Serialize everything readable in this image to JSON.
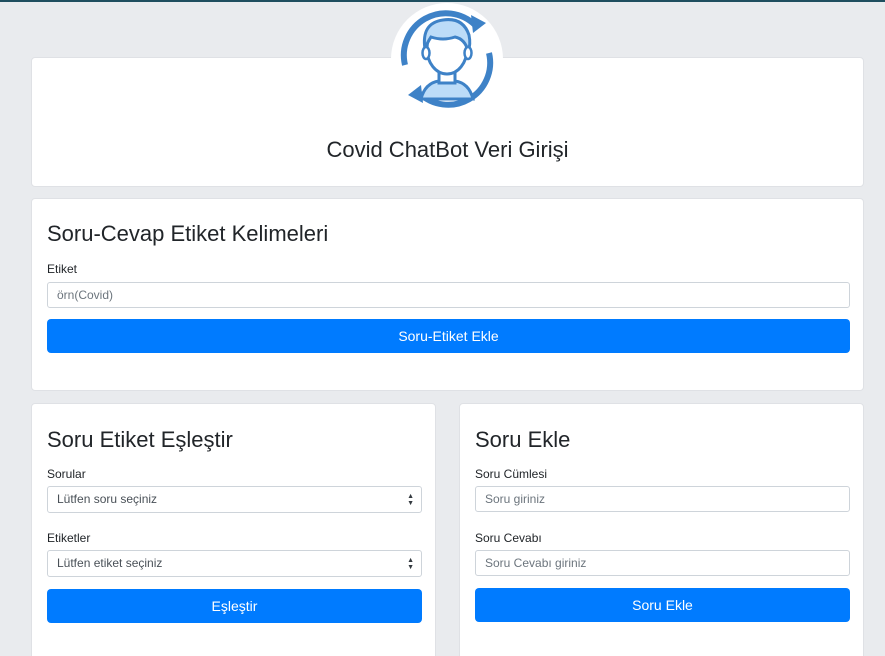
{
  "app": {
    "title": "Covid ChatBot Veri Girişi"
  },
  "logo": {
    "icon": "chatbot-face-refresh-icon",
    "colors": {
      "primary": "#3e82c7",
      "fill": "#bcdcf8"
    }
  },
  "tag_section": {
    "title": "Soru-Cevap Etiket Kelimeleri",
    "label": "Etiket",
    "placeholder": "örn(Covid)",
    "button": "Soru-Etiket Ekle"
  },
  "match_section": {
    "title": "Soru Etiket Eşleştir",
    "questions_label": "Sorular",
    "questions_selected": "Lütfen soru seçiniz",
    "tags_label": "Etiketler",
    "tags_selected": "Lütfen etiket seçiniz",
    "button": "Eşleştir"
  },
  "add_section": {
    "title": "Soru Ekle",
    "sentence_label": "Soru Cümlesi",
    "sentence_placeholder": "Soru giriniz",
    "answer_label": "Soru Cevabı",
    "answer_placeholder": "Soru Cevabı giriniz",
    "button": "Soru Ekle"
  },
  "colors": {
    "accent": "#007bff",
    "background": "#e9ebee",
    "card": "#ffffff"
  }
}
